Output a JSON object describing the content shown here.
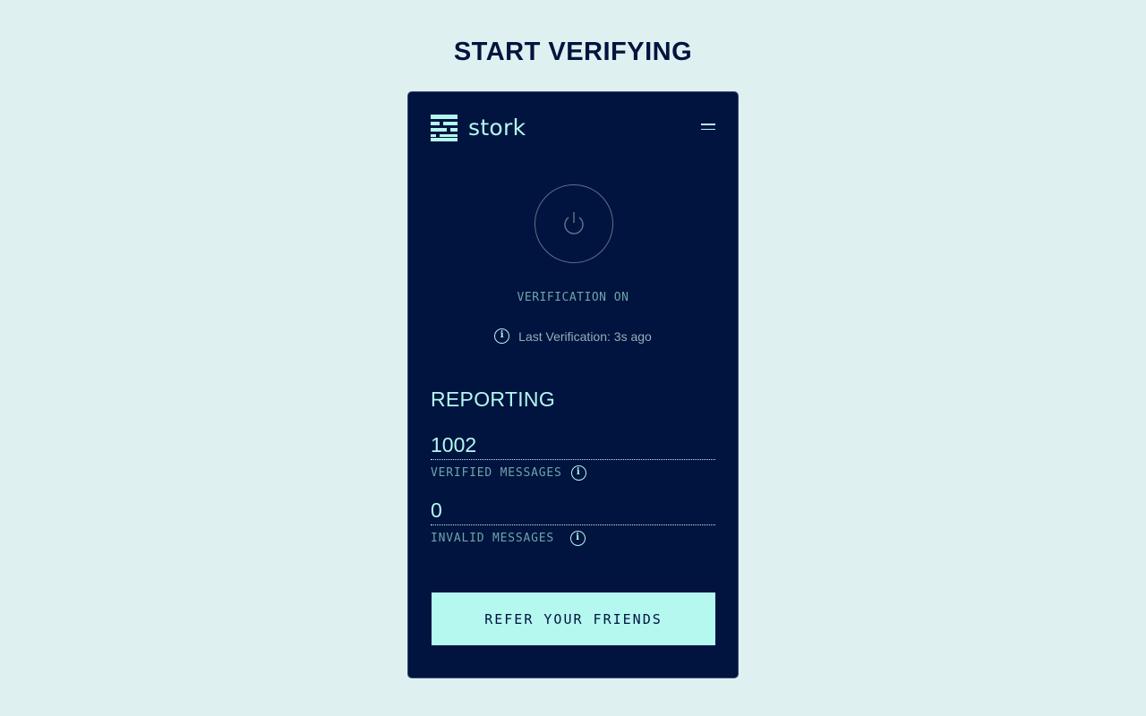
{
  "page": {
    "title": "START VERIFYING"
  },
  "header": {
    "brand": "stork",
    "logo_icon": "stork-logo-icon",
    "menu_icon": "hamburger-menu-icon"
  },
  "verification": {
    "power_icon": "power-icon",
    "status": "VERIFICATION ON",
    "last_verification": "Last Verification: 3s ago",
    "info_icon": "info-icon"
  },
  "reporting": {
    "title": "REPORTING",
    "metrics": [
      {
        "value": "1002",
        "label": "VERIFIED MESSAGES"
      },
      {
        "value": "0",
        "label": "INVALID MESSAGES"
      }
    ]
  },
  "cta": {
    "label": "REFER YOUR FRIENDS"
  },
  "colors": {
    "background": "#dff0f0",
    "panel": "#00143f",
    "accent": "#b4f8f0",
    "muted": "#6fa3a8"
  }
}
